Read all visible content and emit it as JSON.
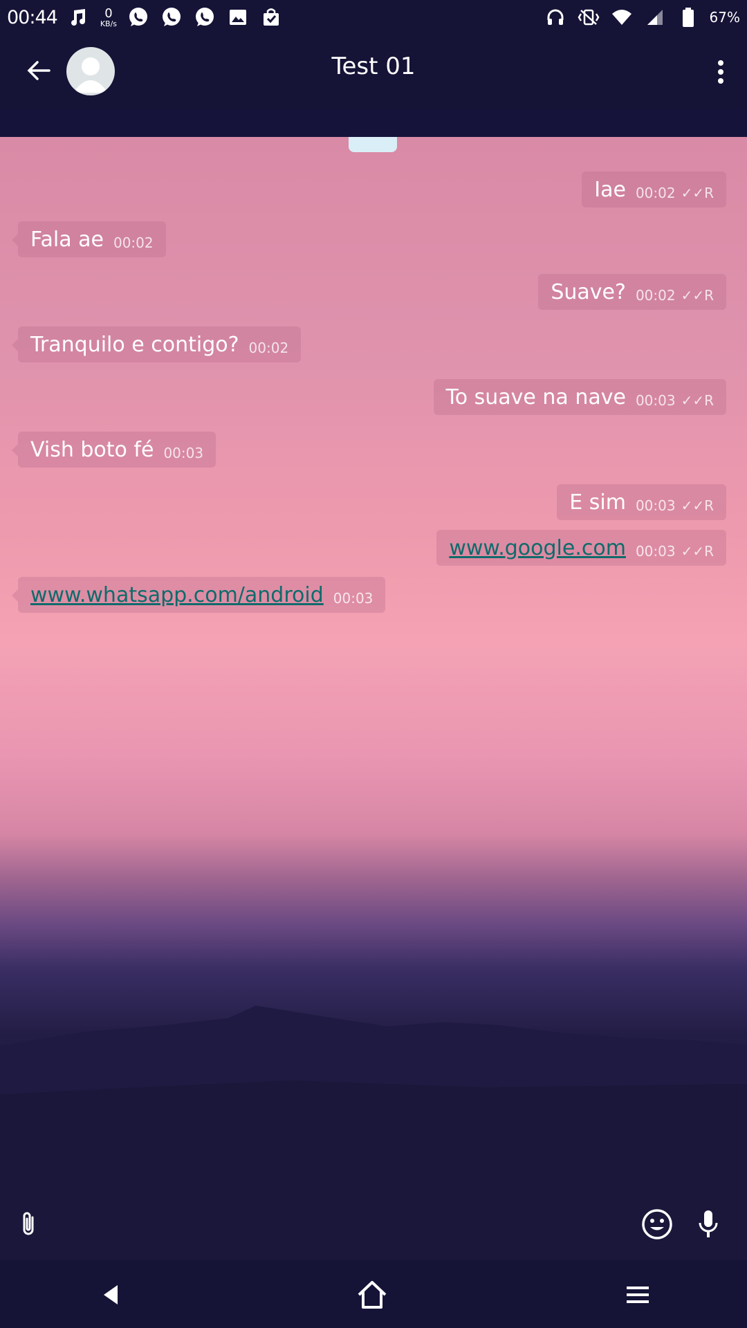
{
  "status_bar": {
    "time": "00:44",
    "netspeed_value": "0",
    "netspeed_unit": "KB/s",
    "battery_percent": "67%",
    "icons_left": [
      "music-note-icon",
      "whatsapp-icon",
      "whatsapp-icon",
      "whatsapp-icon",
      "image-icon",
      "shopping-bag-icon"
    ],
    "icons_right": [
      "headset-icon",
      "vibrate-icon",
      "wifi-icon",
      "signal-icon",
      "battery-icon"
    ]
  },
  "toolbar": {
    "title": "Test 01"
  },
  "messages": [
    {
      "direction": "out",
      "text": "Iae",
      "time": "00:02",
      "status": "✓✓R",
      "link": false
    },
    {
      "direction": "in",
      "text": "Fala ae",
      "time": "00:02",
      "link": false
    },
    {
      "direction": "out",
      "text": "Suave?",
      "time": "00:02",
      "status": "✓✓R",
      "link": false
    },
    {
      "direction": "in",
      "text": "Tranquilo e contigo?",
      "time": "00:02",
      "link": false
    },
    {
      "direction": "out",
      "text": "To suave na nave",
      "time": "00:03",
      "status": "✓✓R",
      "link": false
    },
    {
      "direction": "in",
      "text": "Vish boto fé",
      "time": "00:03",
      "link": false
    },
    {
      "direction": "out",
      "text": "E sim",
      "time": "00:03",
      "status": "✓✓R",
      "link": false
    },
    {
      "direction": "out",
      "text": "www.google.com",
      "time": "00:03",
      "status": "✓✓R",
      "link": true
    },
    {
      "direction": "in",
      "text": "www.whatsapp.com/android",
      "time": "00:03",
      "link": true
    }
  ],
  "colors": {
    "bar_background": "#151336",
    "link": "#0e6b6b",
    "bubble": "rgba(185,110,140,0.35)"
  }
}
